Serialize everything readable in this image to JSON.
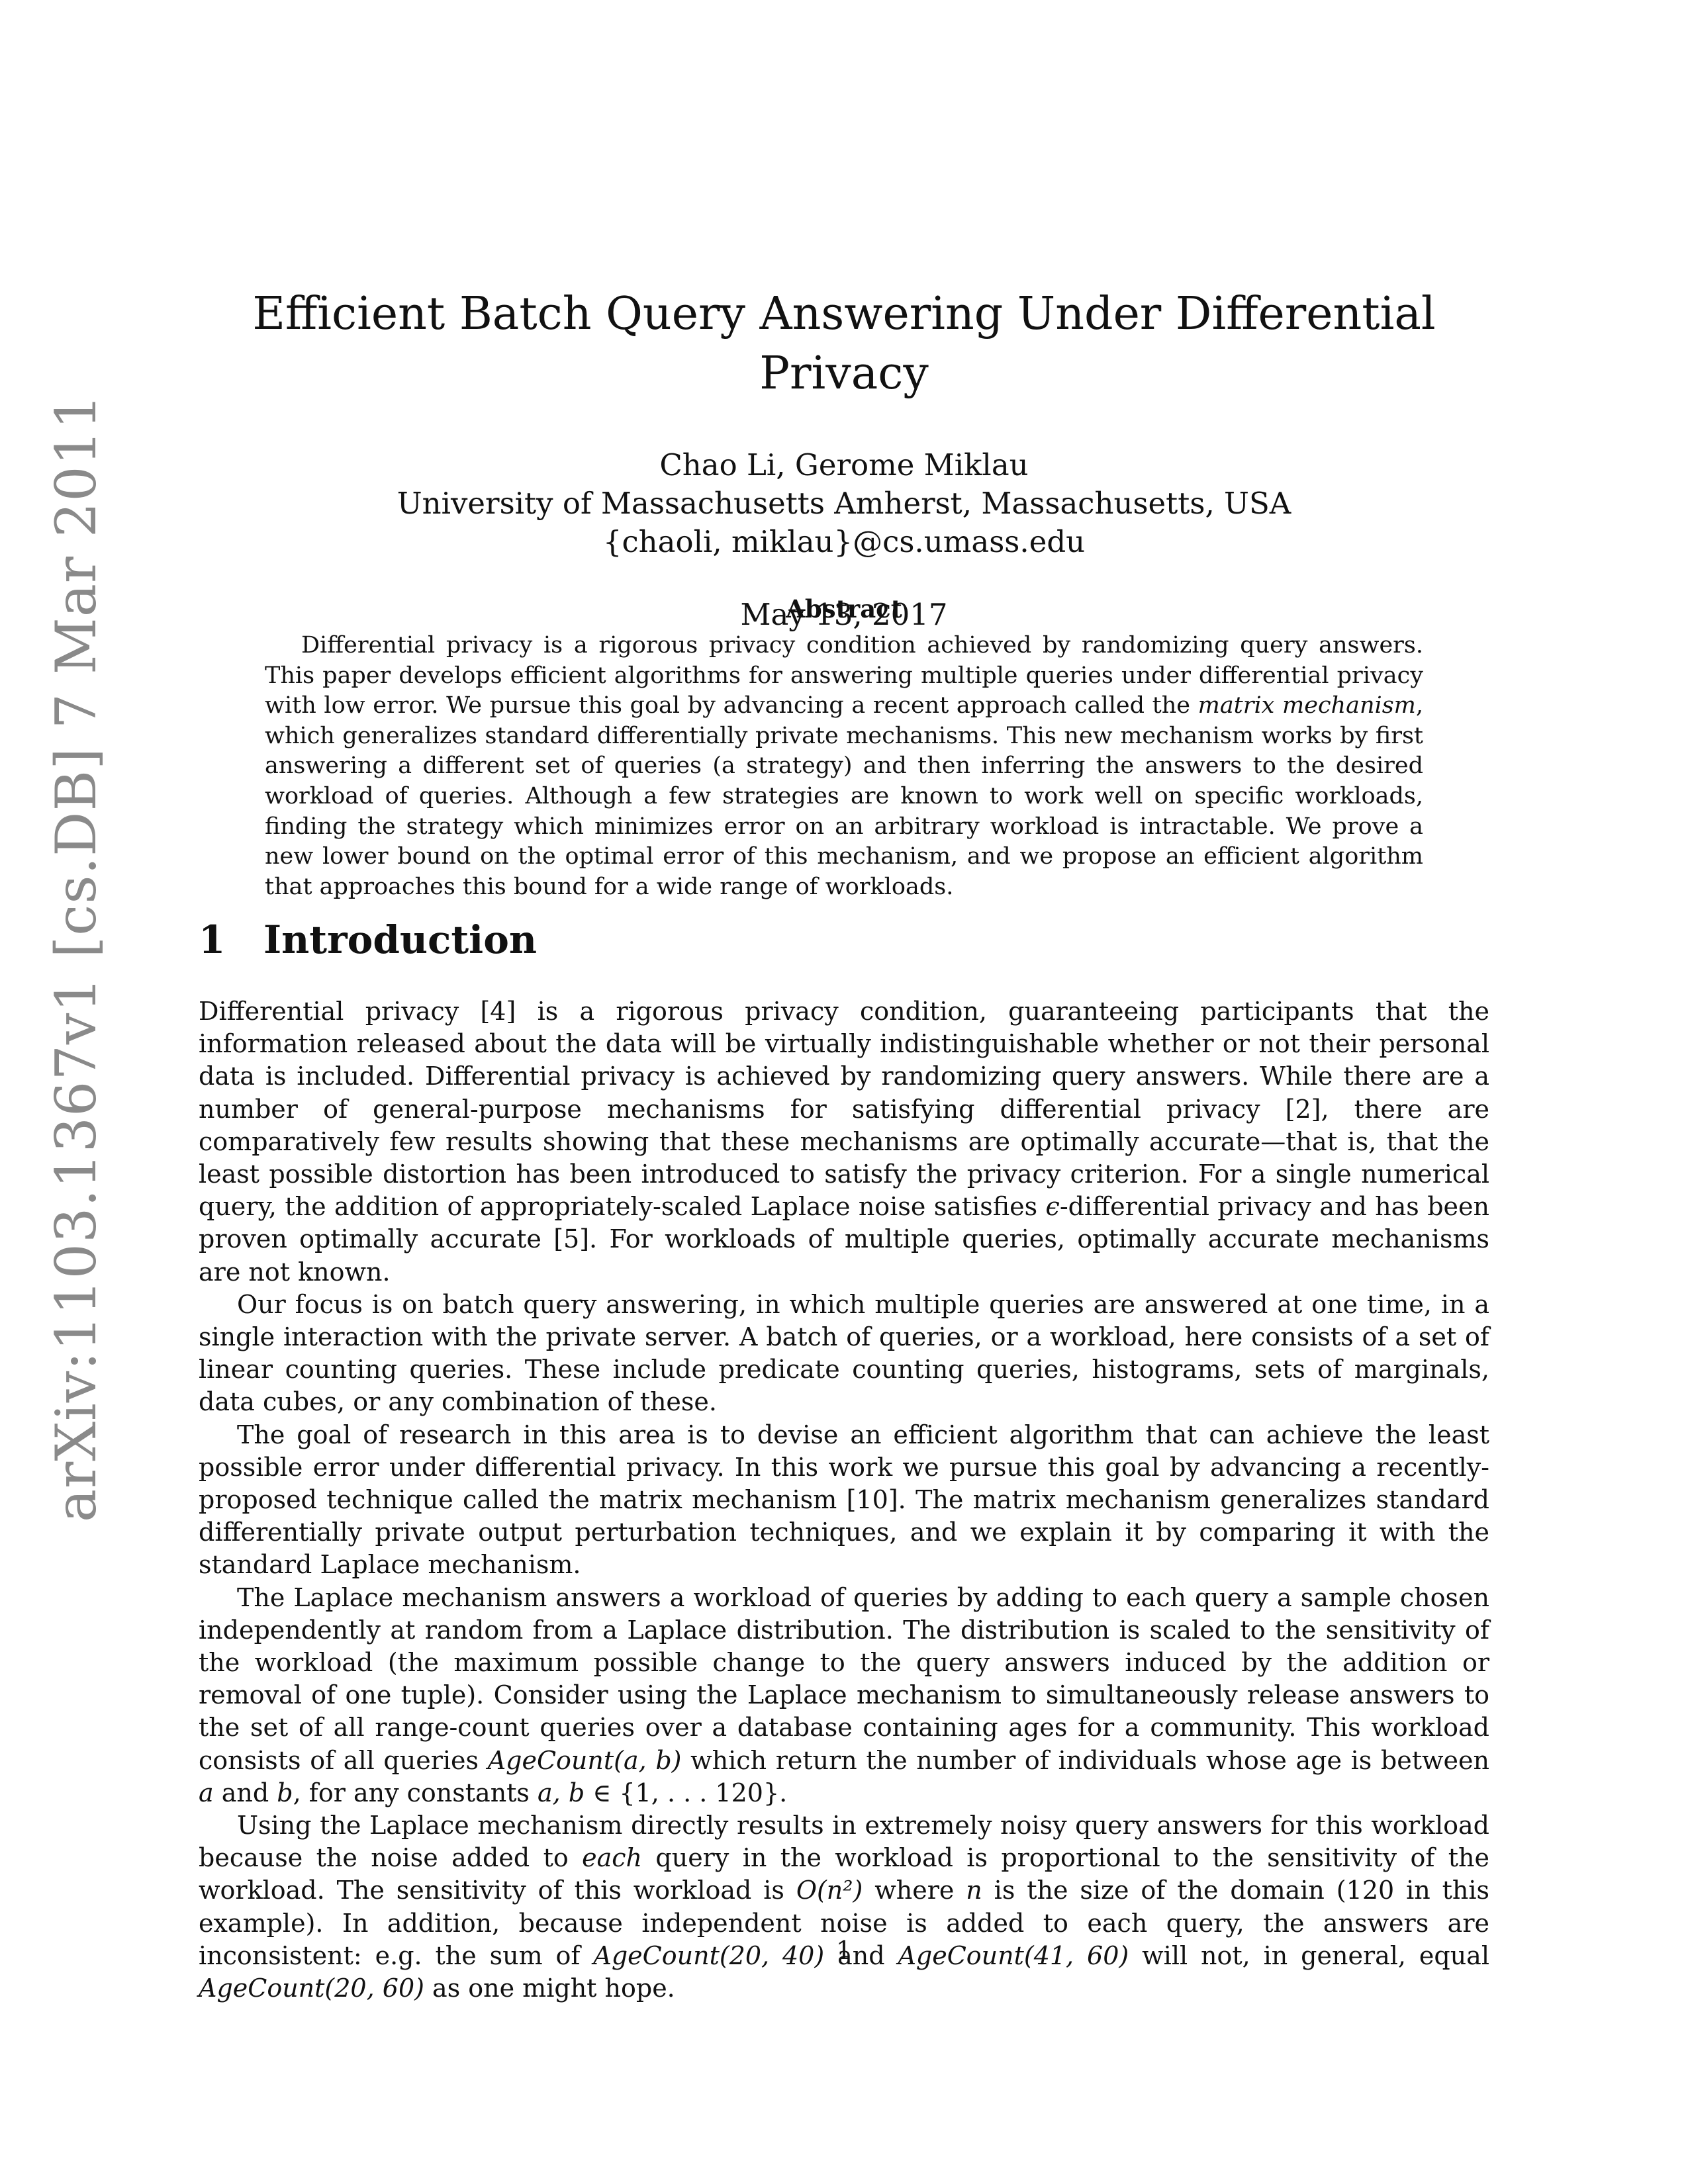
{
  "arxiv_id": "arXiv:1103.1367v1  [cs.DB]  7 Mar 2011",
  "title": "Efficient Batch Query Answering Under Differential Privacy",
  "authors": {
    "names": "Chao Li, Gerome Miklau",
    "affiliation": "University of Massachusetts Amherst, Massachusetts, USA",
    "email": "{chaoli, miklau}@cs.umass.edu"
  },
  "date": "May 13, 2017",
  "abstract": {
    "heading": "Abstract",
    "text_1": "Differential privacy is a rigorous privacy condition achieved by randomizing query answers. This paper develops efficient algorithms for answering multiple queries under differential privacy with low error. We pursue this goal by advancing a recent approach called the ",
    "emphasis": "matrix mechanism",
    "text_2": ", which generalizes standard differentially private mechanisms. This new mechanism works by first answering a different set of queries (a strategy) and then inferring the answers to the desired workload of queries. Although a few strategies are known to work well on specific workloads, finding the strategy which minimizes error on an arbitrary workload is intractable. We prove a new lower bound on the optimal error of this mechanism, and we propose an efficient algorithm that approaches this bound for a wide range of workloads."
  },
  "section": {
    "number": "1",
    "title": "Introduction",
    "p1": {
      "a": "Differential privacy [4] is a rigorous privacy condition, guaranteeing participants that the information released about the data will be virtually indistinguishable whether or not their personal data is included. Differential privacy is achieved by randomizing query answers. While there are a number of general-purpose mechanisms for satisfying differential privacy [2], there are comparatively few results showing that these mechanisms are optimally accurate—that is, that the least possible distortion has been introduced to satisfy the privacy criterion. For a single numerical query, the addition of appropriately-scaled Laplace noise satisfies ",
      "eps": "ϵ",
      "b": "-differential privacy and has been proven optimally accurate [5]. For workloads of multiple queries, optimally accurate mechanisms are not known."
    },
    "p2": "Our focus is on batch query answering, in which multiple queries are answered at one time, in a single interaction with the private server. A batch of queries, or a workload, here consists of a set of linear counting queries. These include predicate counting queries, histograms, sets of marginals, data cubes, or any combination of these.",
    "p3": "The goal of research in this area is to devise an efficient algorithm that can achieve the least possible error under differential privacy. In this work we pursue this goal by advancing a recently-proposed technique called the matrix mechanism [10]. The matrix mechanism generalizes standard differentially private output perturbation techniques, and we explain it by comparing it with the standard Laplace mechanism.",
    "p4": {
      "a": "The Laplace mechanism answers a workload of queries by adding to each query a sample chosen independently at random from a Laplace distribution. The distribution is scaled to the sensitivity of the workload (the maximum possible change to the query answers induced by the addition or removal of one tuple). Consider using the Laplace mechanism to simultaneously release answers to the set of all range-count queries over a database containing ages for a community. This workload consists of all queries ",
      "agecount_ab": "AgeCount(a, b)",
      "b": " which return the number of individuals whose age is between ",
      "var_a": "a",
      "c": " and ",
      "var_b": "b",
      "d": ", for any constants ",
      "var_ab": "a, b",
      "e": " ∈ {1, . . . 120}."
    },
    "p5": {
      "a": "Using the Laplace mechanism directly results in extremely noisy query answers for this workload because the noise added to ",
      "each": "each",
      "b": " query in the workload is proportional to the sensitivity of the workload. The sensitivity of this workload is ",
      "big_o": "O(n²)",
      "c": " where ",
      "var_n": "n",
      "d": " is the size of the domain (120 in this example). In addition, because independent noise is added to each query, the answers are inconsistent: e.g. the sum of ",
      "q1": "AgeCount(20, 40)",
      "e": " and ",
      "q2": "AgeCount(41, 60)",
      "f": " will not, in general, equal ",
      "q3": "AgeCount(20, 60)",
      "g": " as one might hope."
    }
  },
  "page_number": "1"
}
